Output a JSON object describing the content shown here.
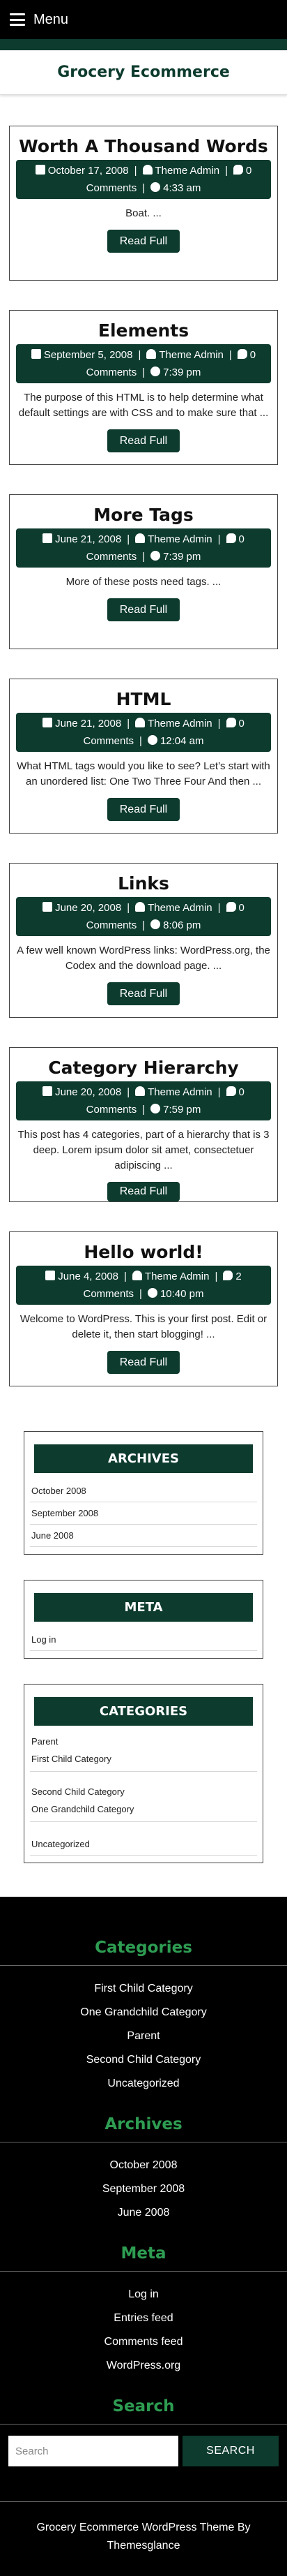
{
  "topbar": {
    "menu_label": "Menu"
  },
  "header": {
    "site_title": "Grocery Ecommerce"
  },
  "posts": [
    {
      "title": "Worth A Thousand Words",
      "date": "October 17, 2008",
      "author": "Theme Admin",
      "comments": "0 Comments",
      "time": "4:33 am",
      "excerpt": "Boat. ...",
      "read_label": "Read Full"
    },
    {
      "title": "Elements",
      "date": "September 5, 2008",
      "author": "Theme Admin",
      "comments": "0 Comments",
      "time": "7:39 pm",
      "excerpt": "The purpose of this HTML is to help determine what default settings are with CSS and to make sure that ...",
      "read_label": "Read Full"
    },
    {
      "title": "More Tags",
      "date": "June 21, 2008",
      "author": "Theme Admin",
      "comments": "0 Comments",
      "time": "7:39 pm",
      "excerpt": "More of these posts need tags. ...",
      "read_label": "Read Full"
    },
    {
      "title": "HTML",
      "date": "June 21, 2008",
      "author": "Theme Admin",
      "comments": "0 Comments",
      "time": "12:04 am",
      "excerpt": "What HTML tags would you like to see? Let’s start with an unordered list: One Two Three Four And then ...",
      "read_label": "Read Full"
    },
    {
      "title": "Links",
      "date": "June 20, 2008",
      "author": "Theme Admin",
      "comments": "0 Comments",
      "time": "8:06 pm",
      "excerpt": "A few well known WordPress links: WordPress.org, the Codex and the download page. ...",
      "read_label": "Read Full"
    },
    {
      "title": "Category Hierarchy",
      "date": "June 20, 2008",
      "author": "Theme Admin",
      "comments": "0 Comments",
      "time": "7:59 pm",
      "excerpt": "This post has 4 categories, part of a hierarchy that is 3 deep. Lorem ipsum dolor sit amet, consectetuer adipiscing ...",
      "read_label": "Read Full"
    },
    {
      "title": "Hello world!",
      "date": "June 4, 2008",
      "author": "Theme Admin",
      "comments": "2 Comments",
      "time": "10:40 pm",
      "excerpt": "Welcome to WordPress. This is your first post. Edit or delete it, then start blogging! ...",
      "read_label": "Read Full"
    }
  ],
  "sidebar": {
    "archives": {
      "title": "ARCHIVES",
      "items": [
        "October 2008",
        "September 2008",
        "June 2008"
      ]
    },
    "meta": {
      "title": "META",
      "items": [
        "Log in"
      ]
    },
    "categories": {
      "title": "CATEGORIES",
      "items": [
        "Parent",
        "First Child Category",
        "Second Child Category",
        "One Grandchild Category",
        "Uncategorized"
      ]
    }
  },
  "footer": {
    "categories": {
      "title": "Categories",
      "items": [
        "First Child Category",
        "One Grandchild Category",
        "Parent",
        "Second Child Category",
        "Uncategorized"
      ]
    },
    "archives": {
      "title": "Archives",
      "items": [
        "October 2008",
        "September 2008",
        "June 2008"
      ]
    },
    "meta": {
      "title": "Meta",
      "items": [
        "Log in",
        "Entries feed",
        "Comments feed",
        "WordPress.org"
      ]
    },
    "search": {
      "title": "Search",
      "placeholder": "Search",
      "button_label": "SEARCH"
    },
    "credit": "Grocery Ecommerce WordPress Theme By Themesglance"
  },
  "icons": {
    "menu": "hamburger-icon",
    "date": "calendar-icon",
    "author": "user-icon",
    "comments": "comments-icon",
    "time": "clock-icon"
  },
  "colors": {
    "brand_green": "#0d3b2e",
    "footer_title_green": "#2e9d52",
    "footer_bg": "#000000"
  }
}
